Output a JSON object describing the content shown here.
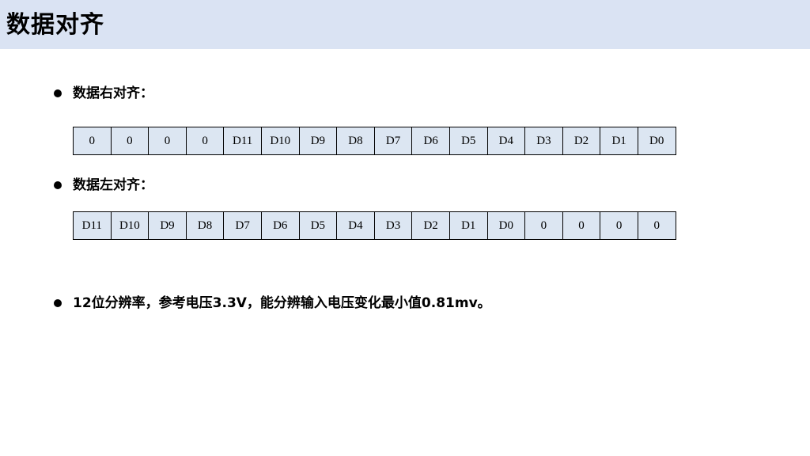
{
  "header": {
    "title": "数据对齐"
  },
  "sections": [
    {
      "label": "数据右对齐：",
      "bits": [
        "0",
        "0",
        "0",
        "0",
        "D11",
        "D10",
        "D9",
        "D8",
        "D7",
        "D6",
        "D5",
        "D4",
        "D3",
        "D2",
        "D1",
        "D0"
      ]
    },
    {
      "label": "数据左对齐：",
      "bits": [
        "D11",
        "D10",
        "D9",
        "D8",
        "D7",
        "D6",
        "D5",
        "D4",
        "D3",
        "D2",
        "D1",
        "D0",
        "0",
        "0",
        "0",
        "0"
      ]
    }
  ],
  "note": {
    "text": "12位分辨率，参考电压3.3V，能分辨输入电压变化最小值0.81mv。"
  },
  "colors": {
    "header_bg": "#dae3f3",
    "cell_bg": "#dce6f2"
  }
}
